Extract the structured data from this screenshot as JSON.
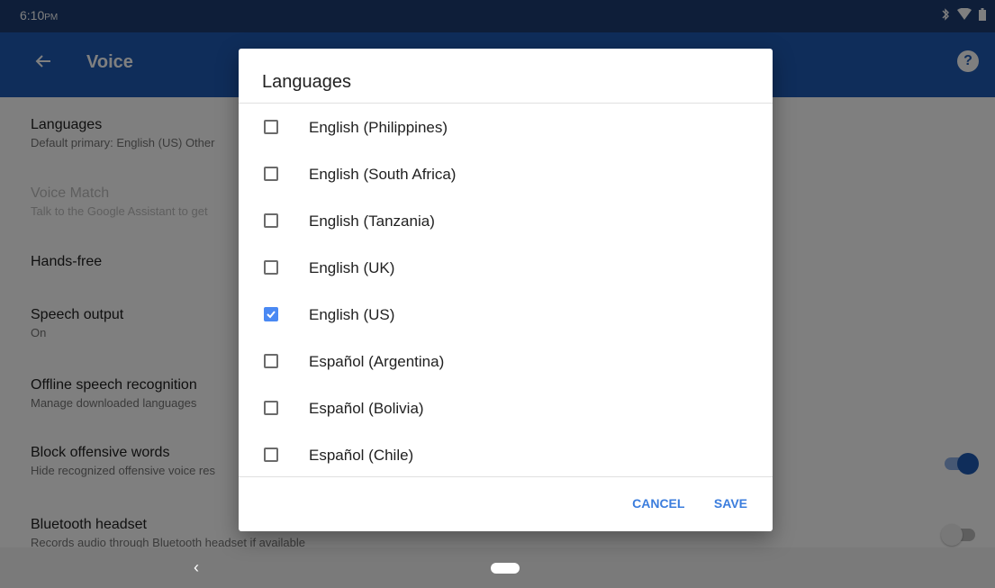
{
  "status_bar": {
    "time": "6:10",
    "meridiem": "PM",
    "icons": [
      "bluetooth-icon",
      "wifi-icon",
      "battery-icon"
    ]
  },
  "app_bar": {
    "title": "Voice",
    "back_icon": "arrow-left-icon",
    "help_icon": "help-circle-icon",
    "help_glyph": "?"
  },
  "settings": [
    {
      "title": "Languages",
      "subtitle": "Default primary: English (US) Other",
      "disabled": false
    },
    {
      "title": "Voice Match",
      "subtitle": "Talk to the Google Assistant to get",
      "disabled": true
    },
    {
      "title": "Hands-free",
      "subtitle": "",
      "disabled": false
    },
    {
      "title": "Speech output",
      "subtitle": "On",
      "disabled": false
    },
    {
      "title": "Offline speech recognition",
      "subtitle": "Manage downloaded languages",
      "disabled": false
    },
    {
      "title": "Block offensive words",
      "subtitle": "Hide recognized offensive voice res",
      "disabled": false,
      "toggle": true
    },
    {
      "title": "Bluetooth headset",
      "subtitle": "Records audio through Bluetooth headset if available",
      "disabled": false,
      "toggle": false
    }
  ],
  "dialog": {
    "title": "Languages",
    "languages": [
      {
        "label": "English (Philippines)",
        "checked": false
      },
      {
        "label": "English (South Africa)",
        "checked": false
      },
      {
        "label": "English (Tanzania)",
        "checked": false
      },
      {
        "label": "English (UK)",
        "checked": false
      },
      {
        "label": "English (US)",
        "checked": true
      },
      {
        "label": "Español (Argentina)",
        "checked": false
      },
      {
        "label": "Español (Bolivia)",
        "checked": false
      },
      {
        "label": "Español (Chile)",
        "checked": false
      }
    ],
    "cancel_label": "CANCEL",
    "save_label": "SAVE"
  },
  "nav_bar": {
    "back_glyph": "‹"
  },
  "colors": {
    "status_bar": "#1c3d72",
    "app_bar": "#1f5bb5",
    "accent": "#3b7ddd",
    "checkbox_checked": "#4a89f3"
  }
}
